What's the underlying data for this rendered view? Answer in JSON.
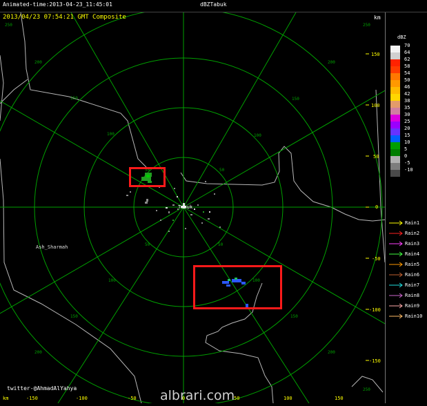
{
  "title_bar": {
    "animated_time": "Animated-time:2013-04-23_11:45:01",
    "product_name": "dBZTabuk"
  },
  "scope": {
    "timestamp": "2013/04/23 07:54:21 GMT Composite",
    "unit_label_right": "km",
    "unit_label_bottom": "km",
    "center_label": "Tabuk",
    "place_label": "Ash_Sharmah",
    "credit": "twitter-@AhmadAlYahya",
    "watermark": "albrari.com",
    "range_ring_labels": [
      "50",
      "100",
      "150",
      "200"
    ],
    "right_axis_ticks": [
      "150",
      "100",
      "50",
      "0",
      "-50",
      "-100",
      "-150"
    ],
    "bottom_axis_ticks": [
      "-150",
      "-100",
      "-50",
      "0",
      "50",
      "100",
      "150"
    ],
    "corner_label": "250",
    "colors": {
      "grid": "#00a000",
      "ticks": "#ffff00",
      "borders": "#b8b8b8",
      "highlight_box": "#ff1a1a"
    }
  },
  "legend": {
    "unit": "dBZ",
    "scale": [
      {
        "label": "70",
        "color": "#f2f2f2"
      },
      {
        "label": "64",
        "color": "#d0d0d0"
      },
      {
        "label": "62",
        "color": "#ff2200"
      },
      {
        "label": "58",
        "color": "#ff3c00"
      },
      {
        "label": "54",
        "color": "#ff7700"
      },
      {
        "label": "50",
        "color": "#ff9900"
      },
      {
        "label": "46",
        "color": "#ffbb00"
      },
      {
        "label": "42",
        "color": "#ffd700"
      },
      {
        "label": "38",
        "color": "#e39b6b"
      },
      {
        "label": "35",
        "color": "#d07fa0"
      },
      {
        "label": "30",
        "color": "#dd00dd"
      },
      {
        "label": "25",
        "color": "#9a00ff"
      },
      {
        "label": "20",
        "color": "#6633ff"
      },
      {
        "label": "15",
        "color": "#0060ff"
      },
      {
        "label": "10",
        "color": "#009e00"
      },
      {
        "label": "5",
        "color": "#007d00"
      },
      {
        "label": "0",
        "color": "#b0b0b0"
      },
      {
        "label": "-5",
        "color": "#7d7d7d"
      },
      {
        "label": "-10",
        "color": "#4a4a4a"
      }
    ],
    "rain_series": [
      {
        "label": "Rain1",
        "color": "#ffff00"
      },
      {
        "label": "Rain2",
        "color": "#ff2020"
      },
      {
        "label": "Rain3",
        "color": "#ff40ff"
      },
      {
        "label": "Rain4",
        "color": "#40ff40"
      },
      {
        "label": "Rain5",
        "color": "#ff9900"
      },
      {
        "label": "Rain6",
        "color": "#c06030"
      },
      {
        "label": "Rain7",
        "color": "#20e0e0"
      },
      {
        "label": "Rain8",
        "color": "#cc66cc"
      },
      {
        "label": "Rain9",
        "color": "#ffaaaa"
      },
      {
        "label": "Rain10",
        "color": "#ffbb66"
      }
    ]
  }
}
